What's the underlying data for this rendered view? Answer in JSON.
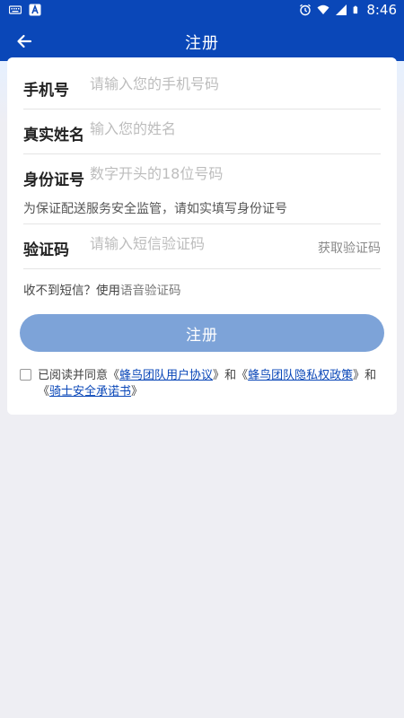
{
  "status_bar": {
    "time": "8:46"
  },
  "header": {
    "title": "注册"
  },
  "form": {
    "phone": {
      "label": "手机号",
      "placeholder": "请输入您的手机号码"
    },
    "name": {
      "label": "真实姓名",
      "placeholder": "输入您的姓名"
    },
    "id_card": {
      "label": "身份证号",
      "placeholder": "数字开头的18位号码",
      "hint": "为保证配送服务安全监管，请如实填写身份证号"
    },
    "code": {
      "label": "验证码",
      "placeholder": "请输入短信验证码",
      "get_code": "获取验证码"
    },
    "voice_prefix": "收不到短信？使用",
    "voice_link": "语音验证码",
    "submit": "注册"
  },
  "agreement": {
    "prefix": "已阅读并同意",
    "lq": "《",
    "rq": "》",
    "conj": "和",
    "doc1": "蜂鸟团队用户协议",
    "doc2": "蜂鸟团队隐私权政策",
    "doc3": "骑士安全承诺书"
  },
  "colors": {
    "primary": "#0a47b8",
    "button": "#7da3d8",
    "background": "#eeeef3"
  }
}
